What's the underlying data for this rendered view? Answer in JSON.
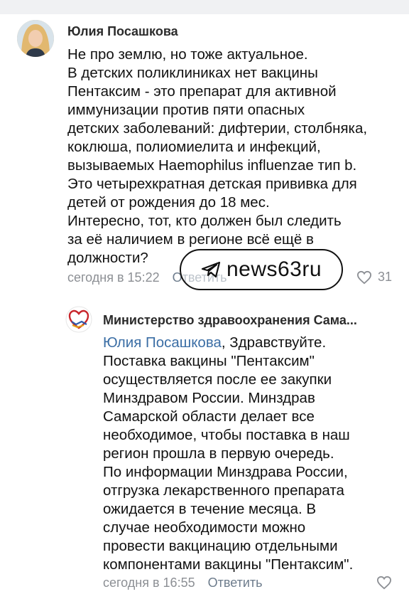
{
  "comments": [
    {
      "author": "Юлия Посашкова",
      "lines": [
        "Не про землю, но тоже актуальное.",
        "В детских поликлиниках нет вакцины",
        "Пентаксим - это препарат для активной",
        "иммунизации против пяти опасных",
        "детских заболеваний: дифтерии, столбняка,",
        "коклюша, полиомиелита и инфекций,",
        "вызываемых Haemophilus influenzae тип b.",
        "Это четырехкратная детская прививка для",
        "детей от рождения до 18 мес.",
        "Интересно, тот, кто должен был следить",
        "за её наличием в регионе всё ещё в",
        "должности?"
      ],
      "time": "сегодня в 15:22",
      "reply_label": "Ответить",
      "likes": "31",
      "icons": {
        "avatar": "user-avatar",
        "like": "heart-icon"
      }
    },
    {
      "author": "Министерство здравоохранения Сама...",
      "mention": "Юлия Посашкова",
      "first_line_rest": ", Здравствуйте.",
      "lines": [
        "Поставка вакцины \"Пентаксим\"",
        "осуществляется после ее закупки",
        "Минздравом России. Минздрав",
        "Самарской области делает все",
        "необходимое, чтобы поставка в наш",
        "регион прошла в первую очередь.",
        "По информации Минздрава России,",
        "отгрузка лекарственного препарата",
        "ожидается в течение месяца. В",
        "случае необходимости можно",
        "провести вакцинацию отдельными",
        "компонентами вакцины \"Пентаксим\"."
      ],
      "time": "сегодня в 16:55",
      "reply_label": "Ответить",
      "likes": "",
      "icons": {
        "avatar": "ministry-logo",
        "like": "heart-icon"
      }
    }
  ],
  "watermark": {
    "text": "news63ru",
    "icon": "telegram-icon"
  },
  "colors": {
    "mention": "#3b6ea5",
    "meta": "#8c8f94",
    "reply": "#6d7c8c",
    "background": "#ffffff"
  }
}
